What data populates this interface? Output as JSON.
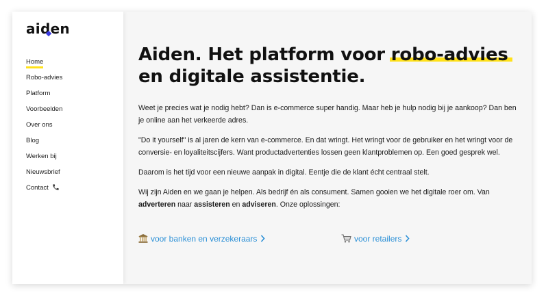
{
  "brand": {
    "logo_text": "aiden",
    "accent_color": "#ffe11a",
    "logo_dot_color": "#3a3ae0",
    "link_color": "#2a8fd6"
  },
  "sidebar": {
    "items": [
      {
        "label": "Home",
        "active": true
      },
      {
        "label": "Robo-advies"
      },
      {
        "label": "Platform"
      },
      {
        "label": "Voorbeelden"
      },
      {
        "label": "Over ons"
      },
      {
        "label": "Blog"
      },
      {
        "label": "Werken bij"
      },
      {
        "label": "Nieuwsbrief"
      },
      {
        "label": "Contact",
        "icon": "phone-icon"
      }
    ]
  },
  "main": {
    "headline_part1": "Aiden. Het platform voor ",
    "headline_highlight": "robo-advies",
    "headline_part2": "en digitale assistentie.",
    "paragraphs": {
      "p1": "Weet je precies wat je nodig hebt? Dan is e-commerce super handig. Maar heb je hulp nodig bij je aankoop? Dan ben je online aan het verkeerde adres.",
      "p2": "\"Do it yourself\" is al jaren de kern van e-commerce. En dat wringt. Het wringt voor de gebruiker en het wringt voor de conversie- en loyaliteitscijfers. Want productadvertenties lossen geen klantproblemen op. Een goed gesprek wel.",
      "p3": "Daarom is het tijd voor een nieuwe aanpak in digital. Eentje die de klant écht centraal stelt.",
      "p4_a": "Wij zijn Aiden en we gaan je helpen. Als bedrijf én als consument. Samen gooien we het digitale roer om. Van ",
      "p4_b1": "adverteren",
      "p4_mid1": " naar ",
      "p4_b2": "assisteren",
      "p4_mid2": " en ",
      "p4_b3": "adviseren",
      "p4_end": ". Onze oplossingen:"
    },
    "links": {
      "banks": {
        "label": "voor banken en verzekeraars",
        "icon": "bank-icon"
      },
      "retail": {
        "label": "voor retailers",
        "icon": "cart-icon"
      }
    }
  }
}
